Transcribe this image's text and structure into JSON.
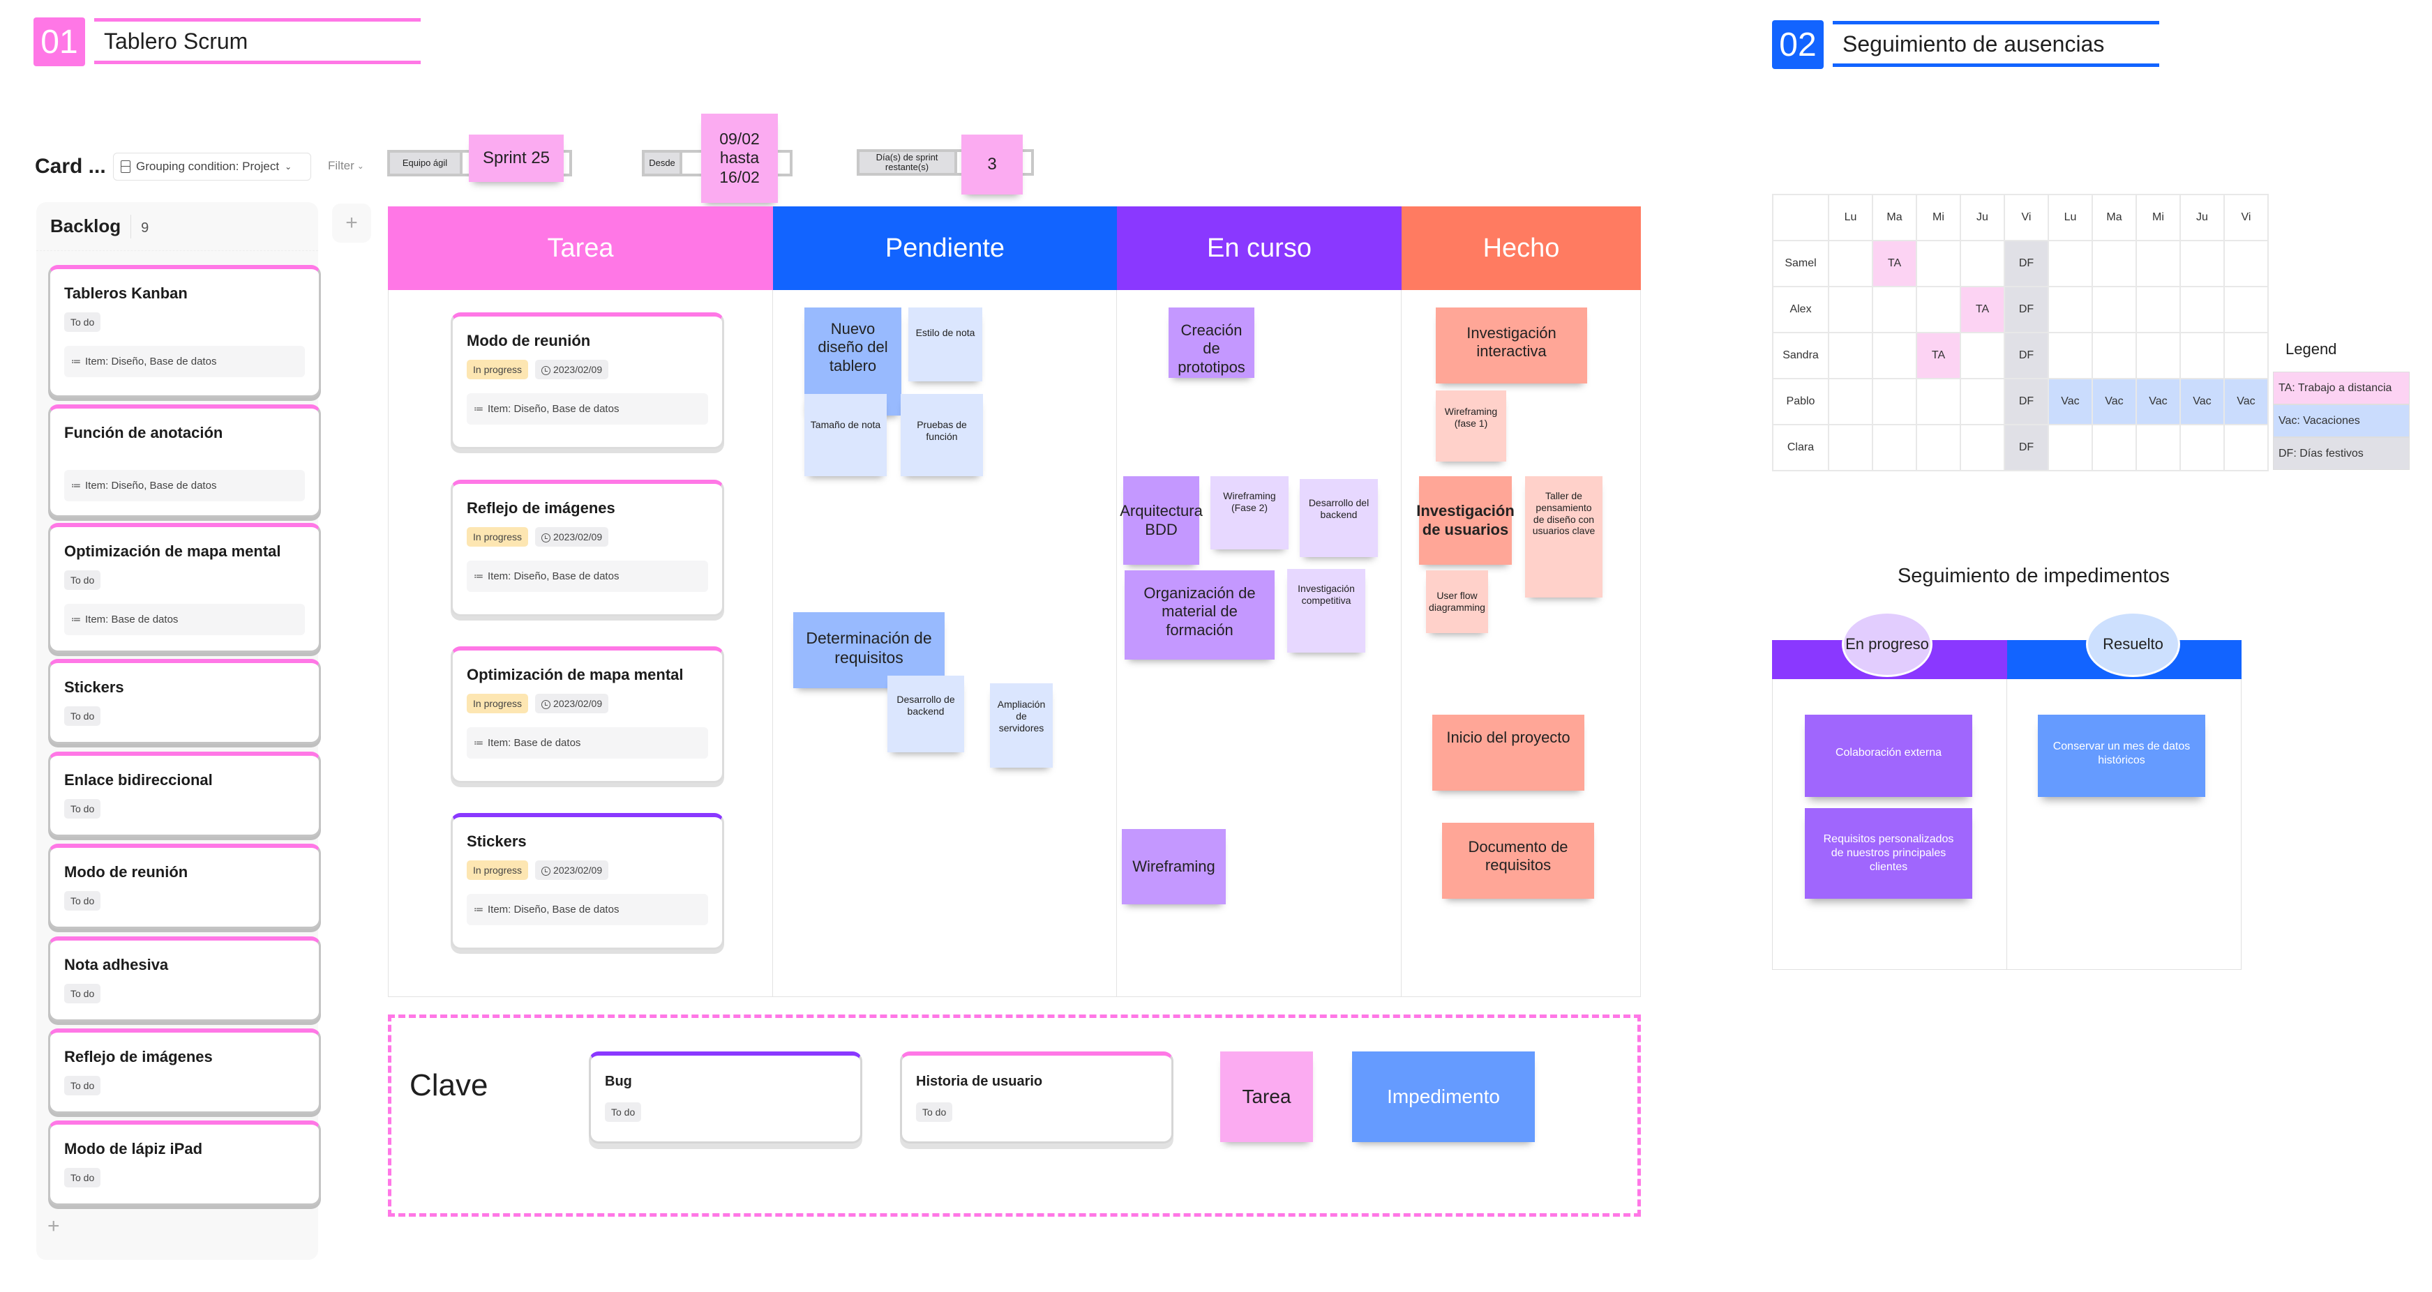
{
  "colors": {
    "pink": "#ff77e6",
    "blue": "#1264ff",
    "purple": "#8a38ff",
    "coral": "#ff7b61",
    "sticky_pink": "#fbabf1",
    "sticky_blue_strong": "#98bafe",
    "sticky_blue_light": "#dbe6fe",
    "sticky_purple_strong": "#c498ff",
    "sticky_purple_light": "#e7d8ff",
    "sticky_coral_strong": "#ffa697",
    "sticky_coral_light": "#ffd1ca",
    "imp_purple": "#a066fd",
    "imp_blue": "#659bff"
  },
  "section1": {
    "number": "01",
    "title": "Tablero Scrum"
  },
  "section2": {
    "number": "02",
    "title": "Seguimiento de ausencias"
  },
  "toolbar": {
    "title": "Card ...",
    "grouping_label": "Grouping condition: Project",
    "filter_label": "Filter"
  },
  "sprint_info": {
    "team_label": "Equipo ágil",
    "sprint_value": "Sprint 25",
    "from_label": "Desde",
    "date_range": "09/02 hasta 16/02",
    "days_label": "Día(s) de sprint restante(s)",
    "days_value": "3"
  },
  "backlog": {
    "title": "Backlog",
    "count": "9",
    "add_column_label": "+",
    "add_card_label": "+",
    "cards": [
      {
        "title": "Tableros Kanban",
        "status": "To do",
        "item": "Item: Diseño, Base de datos"
      },
      {
        "title": "Función de anotación",
        "status": "",
        "item": "Item: Diseño, Base de datos"
      },
      {
        "title": "Optimización de mapa mental",
        "status": "To do",
        "item": "Item: Base de datos"
      },
      {
        "title": "Stickers",
        "status": "To do",
        "item": ""
      },
      {
        "title": "Enlace bidireccional",
        "status": "To do",
        "item": ""
      },
      {
        "title": "Modo de reunión",
        "status": "To do",
        "item": ""
      },
      {
        "title": "Nota adhesiva",
        "status": "To do",
        "item": ""
      },
      {
        "title": "Reflejo de imágenes",
        "status": "To do",
        "item": ""
      },
      {
        "title": "Modo de lápiz iPad",
        "status": "To do",
        "item": ""
      }
    ]
  },
  "board": {
    "columns": [
      {
        "title": "Tarea"
      },
      {
        "title": "Pendiente"
      },
      {
        "title": "En curso"
      },
      {
        "title": "Hecho"
      }
    ],
    "tarea_cards": [
      {
        "title": "Modo de reunión",
        "status": "In progress",
        "date": "2023/02/09",
        "item": "Item: Diseño, Base de datos",
        "accent": "pink"
      },
      {
        "title": "Reflejo de imágenes",
        "status": "In progress",
        "date": "2023/02/09",
        "item": "Item: Diseño, Base de datos",
        "accent": "pink"
      },
      {
        "title": "Optimización de mapa mental",
        "status": "In progress",
        "date": "2023/02/09",
        "item": "Item: Base de datos",
        "accent": "pink"
      },
      {
        "title": "Stickers",
        "status": "In progress",
        "date": "2023/02/09",
        "item": "Item: Diseño, Base de datos",
        "accent": "purple"
      }
    ],
    "pendiente_notes": [
      "Nuevo diseño del tablero",
      "Estilo de nota",
      "Tamaño de nota",
      "Pruebas de función",
      "Determinación de requisitos",
      "Desarrollo de backend",
      "Ampliación de servidores"
    ],
    "en_curso_notes": [
      "Creación de prototipos",
      "Arquitectura BDD",
      "Wireframing (Fase 2)",
      "Desarrollo del backend",
      "Organización de material de formación",
      "Investigación competitiva",
      "Wireframing"
    ],
    "hecho_notes": [
      "Investigación interactiva",
      "Wireframing (fase 1)",
      "Investigación de usuarios",
      "Taller de pensamiento de diseño con usuarios clave",
      "User flow diagramming",
      "Inicio del proyecto",
      "Documento de requisitos"
    ]
  },
  "key": {
    "title": "Clave",
    "bug": {
      "title": "Bug",
      "status": "To do"
    },
    "user_story": {
      "title": "Historia de usuario",
      "status": "To do"
    },
    "task": "Tarea",
    "impediment": "Impedimento"
  },
  "absences": {
    "days": [
      "Lu",
      "Ma",
      "Mi",
      "Ju",
      "Vi",
      "Lu",
      "Ma",
      "Mi",
      "Ju",
      "Vi"
    ],
    "rows": [
      {
        "name": "Samel",
        "cells": [
          "",
          "TA",
          "",
          "",
          "DF",
          "",
          "",
          "",
          "",
          ""
        ]
      },
      {
        "name": "Alex",
        "cells": [
          "",
          "",
          "",
          "TA",
          "DF",
          "",
          "",
          "",
          "",
          ""
        ]
      },
      {
        "name": "Sandra",
        "cells": [
          "",
          "",
          "TA",
          "",
          "DF",
          "",
          "",
          "",
          "",
          ""
        ]
      },
      {
        "name": "Pablo",
        "cells": [
          "",
          "",
          "",
          "",
          "DF",
          "Vac",
          "Vac",
          "Vac",
          "Vac",
          "Vac"
        ]
      },
      {
        "name": "Clara",
        "cells": [
          "",
          "",
          "",
          "",
          "DF",
          "",
          "",
          "",
          "",
          ""
        ]
      }
    ],
    "legend": {
      "title": "Legend",
      "items": [
        {
          "code": "TA",
          "label": "TA: Trabajo a distancia",
          "color": "#fcd3f3"
        },
        {
          "code": "Vac",
          "label": "Vac: Vacaciones",
          "color": "#cadcfd"
        },
        {
          "code": "DF",
          "label": "DF: Días festivos",
          "color": "#e0e0e6"
        }
      ]
    }
  },
  "impediments": {
    "title": "Seguimiento de impedimentos",
    "columns": [
      {
        "title": "En progreso",
        "notes": [
          "Colaboración externa",
          "Requisitos personalizados de nuestros principales clientes"
        ]
      },
      {
        "title": "Resuelto",
        "notes": [
          "Conservar un mes de datos históricos"
        ]
      }
    ]
  }
}
